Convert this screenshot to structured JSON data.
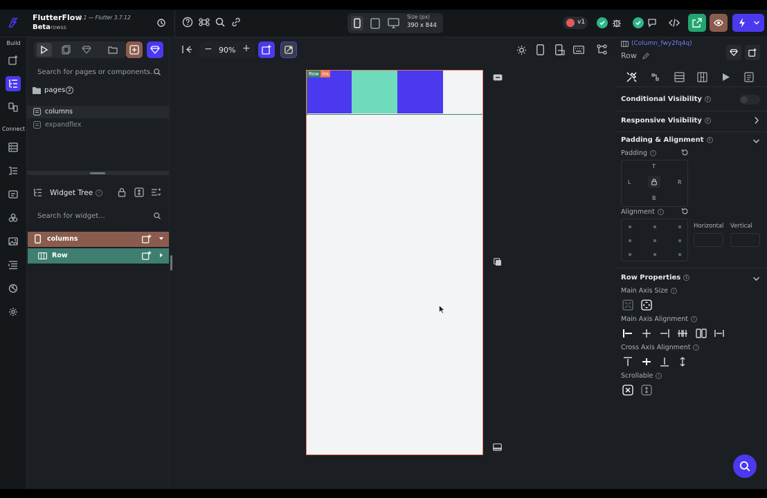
{
  "app": {
    "name": "FlutterFlow",
    "version": "v3.1 — Flutter 3.7.12",
    "channel": "Beta",
    "project": "rowss"
  },
  "device": {
    "size_label": "Size (px)",
    "size_value": "390 x 844"
  },
  "rail": {
    "build_label": "Build",
    "connect_label": "Connect"
  },
  "toolbar": {
    "zoom": "90%",
    "version_badge": "v1"
  },
  "pages_panel": {
    "search_placeholder": "Search for pages or components...",
    "folder_label": "pages",
    "folder_count": "2",
    "pages": [
      "columns",
      "expandflex"
    ]
  },
  "widget_tree": {
    "title": "Widget Tree",
    "search_placeholder": "Search for widget...",
    "nodes": [
      "columns",
      "Row"
    ]
  },
  "canvas": {
    "selection_tag": "Row",
    "selection_tag_2": "ins",
    "columns": [
      {
        "color": "#4b39ef"
      },
      {
        "color": "#6fdbbc"
      },
      {
        "color": "#4b39ef"
      },
      {
        "color": "#f2f4f6"
      }
    ],
    "screen_bg": "#f2f4f6"
  },
  "props": {
    "widget_id": "(Column_fwy2fq4q)",
    "widget_type": "Row",
    "conditional_visibility": "Conditional Visibility",
    "responsive_visibility": "Responsive Visibility",
    "padding_alignment": "Padding & Alignment",
    "padding": "Padding",
    "pad_t": "T",
    "pad_l": "L",
    "pad_r": "R",
    "pad_b": "B",
    "alignment": "Alignment",
    "horizontal": "Horizontal",
    "vertical": "Vertical",
    "row_properties": "Row Properties",
    "main_axis_size": "Main Axis Size",
    "main_axis_alignment": "Main Axis Alignment",
    "cross_axis_alignment": "Cross Axis Alignment",
    "scrollable": "Scrollable"
  },
  "colors": {
    "primary": "#4b39ef",
    "tertiary": "#6fdbbc",
    "selection_border": "#e6785a",
    "tree_root_bg": "#8a5c4e",
    "tree_row_bg": "#3f7f71"
  }
}
